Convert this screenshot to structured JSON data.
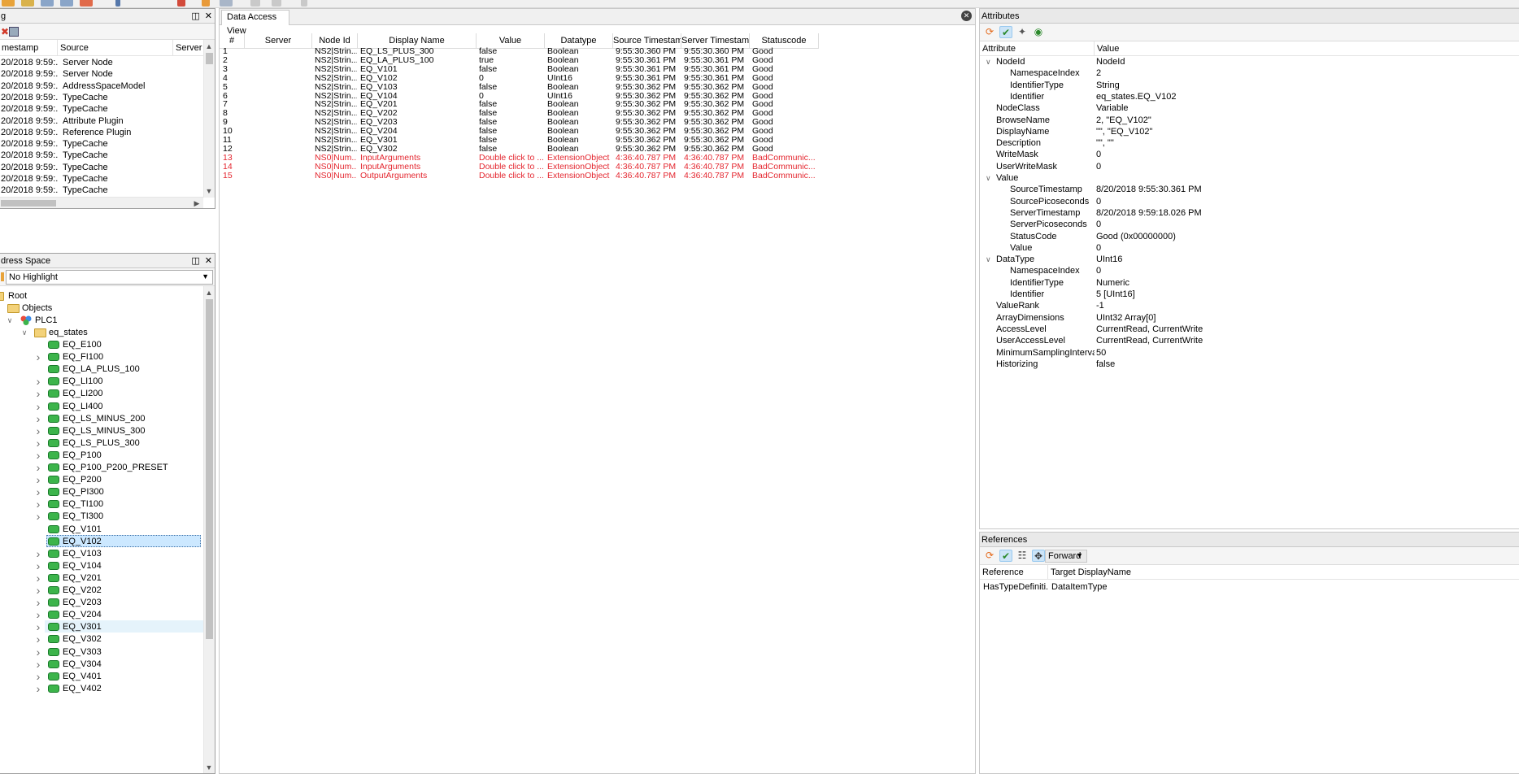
{
  "colors": {
    "good": "#000000",
    "bad": "#e4262f",
    "selection": "#cce8ff"
  },
  "log": {
    "title": "g",
    "columns": [
      "mestamp",
      "Source",
      "Server"
    ],
    "rows": [
      [
        "20/2018 9:59:...",
        "Server Node"
      ],
      [
        "20/2018 9:59:...",
        "Server Node"
      ],
      [
        "20/2018 9:59:...",
        "AddressSpaceModel"
      ],
      [
        "20/2018 9:59:...",
        "TypeCache"
      ],
      [
        "20/2018 9:59:...",
        "TypeCache"
      ],
      [
        "20/2018 9:59:...",
        "Attribute Plugin"
      ],
      [
        "20/2018 9:59:...",
        "Reference Plugin"
      ],
      [
        "20/2018 9:59:...",
        "TypeCache"
      ],
      [
        "20/2018 9:59:...",
        "TypeCache"
      ],
      [
        "20/2018 9:59:...",
        "TypeCache"
      ],
      [
        "20/2018 9:59:...",
        "TypeCache"
      ],
      [
        "20/2018 9:59:...",
        "TypeCache"
      ]
    ]
  },
  "address_space": {
    "title": "dress Space",
    "highlight": "No Highlight",
    "root": "Root",
    "objects": "Objects",
    "plc": "PLC1",
    "folder": "eq_states",
    "items": [
      {
        "label": "EQ_E100",
        "expandable": false
      },
      {
        "label": "EQ_FI100",
        "expandable": true
      },
      {
        "label": "EQ_LA_PLUS_100",
        "expandable": false
      },
      {
        "label": "EQ_LI100",
        "expandable": true
      },
      {
        "label": "EQ_LI200",
        "expandable": true
      },
      {
        "label": "EQ_LI400",
        "expandable": true
      },
      {
        "label": "EQ_LS_MINUS_200",
        "expandable": true
      },
      {
        "label": "EQ_LS_MINUS_300",
        "expandable": true
      },
      {
        "label": "EQ_LS_PLUS_300",
        "expandable": true
      },
      {
        "label": "EQ_P100",
        "expandable": true
      },
      {
        "label": "EQ_P100_P200_PRESET",
        "expandable": true
      },
      {
        "label": "EQ_P200",
        "expandable": true
      },
      {
        "label": "EQ_PI300",
        "expandable": true
      },
      {
        "label": "EQ_TI100",
        "expandable": true
      },
      {
        "label": "EQ_TI300",
        "expandable": true
      },
      {
        "label": "EQ_V101",
        "expandable": false
      },
      {
        "label": "EQ_V102",
        "expandable": false,
        "selected": true
      },
      {
        "label": "EQ_V103",
        "expandable": true
      },
      {
        "label": "EQ_V104",
        "expandable": true
      },
      {
        "label": "EQ_V201",
        "expandable": true
      },
      {
        "label": "EQ_V202",
        "expandable": true
      },
      {
        "label": "EQ_V203",
        "expandable": true
      },
      {
        "label": "EQ_V204",
        "expandable": true
      },
      {
        "label": "EQ_V301",
        "expandable": true,
        "hover": true
      },
      {
        "label": "EQ_V302",
        "expandable": true
      },
      {
        "label": "EQ_V303",
        "expandable": true
      },
      {
        "label": "EQ_V304",
        "expandable": true
      },
      {
        "label": "EQ_V401",
        "expandable": true
      },
      {
        "label": "EQ_V402",
        "expandable": true
      }
    ]
  },
  "data_access": {
    "tab": "Data Access View",
    "columns": [
      "#",
      "Server",
      "Node Id",
      "Display Name",
      "Value",
      "Datatype",
      "Source Timestamp",
      "Server Timestamp",
      "Statuscode"
    ],
    "rows": [
      {
        "n": "1",
        "node": "NS2|Strin...",
        "name": "EQ_LS_PLUS_300",
        "value": "false",
        "type": "Boolean",
        "src": "9:55:30.360 PM",
        "srv": "9:55:30.360 PM",
        "status": "Good",
        "bad": false
      },
      {
        "n": "2",
        "node": "NS2|Strin...",
        "name": "EQ_LA_PLUS_100",
        "value": "true",
        "type": "Boolean",
        "src": "9:55:30.361 PM",
        "srv": "9:55:30.361 PM",
        "status": "Good",
        "bad": false
      },
      {
        "n": "3",
        "node": "NS2|Strin...",
        "name": "EQ_V101",
        "value": "false",
        "type": "Boolean",
        "src": "9:55:30.361 PM",
        "srv": "9:55:30.361 PM",
        "status": "Good",
        "bad": false
      },
      {
        "n": "4",
        "node": "NS2|Strin...",
        "name": "EQ_V102",
        "value": "0",
        "type": "UInt16",
        "src": "9:55:30.361 PM",
        "srv": "9:55:30.361 PM",
        "status": "Good",
        "bad": false
      },
      {
        "n": "5",
        "node": "NS2|Strin...",
        "name": "EQ_V103",
        "value": "false",
        "type": "Boolean",
        "src": "9:55:30.362 PM",
        "srv": "9:55:30.362 PM",
        "status": "Good",
        "bad": false
      },
      {
        "n": "6",
        "node": "NS2|Strin...",
        "name": "EQ_V104",
        "value": "0",
        "type": "UInt16",
        "src": "9:55:30.362 PM",
        "srv": "9:55:30.362 PM",
        "status": "Good",
        "bad": false
      },
      {
        "n": "7",
        "node": "NS2|Strin...",
        "name": "EQ_V201",
        "value": "false",
        "type": "Boolean",
        "src": "9:55:30.362 PM",
        "srv": "9:55:30.362 PM",
        "status": "Good",
        "bad": false
      },
      {
        "n": "8",
        "node": "NS2|Strin...",
        "name": "EQ_V202",
        "value": "false",
        "type": "Boolean",
        "src": "9:55:30.362 PM",
        "srv": "9:55:30.362 PM",
        "status": "Good",
        "bad": false
      },
      {
        "n": "9",
        "node": "NS2|Strin...",
        "name": "EQ_V203",
        "value": "false",
        "type": "Boolean",
        "src": "9:55:30.362 PM",
        "srv": "9:55:30.362 PM",
        "status": "Good",
        "bad": false
      },
      {
        "n": "10",
        "node": "NS2|Strin...",
        "name": "EQ_V204",
        "value": "false",
        "type": "Boolean",
        "src": "9:55:30.362 PM",
        "srv": "9:55:30.362 PM",
        "status": "Good",
        "bad": false
      },
      {
        "n": "11",
        "node": "NS2|Strin...",
        "name": "EQ_V301",
        "value": "false",
        "type": "Boolean",
        "src": "9:55:30.362 PM",
        "srv": "9:55:30.362 PM",
        "status": "Good",
        "bad": false
      },
      {
        "n": "12",
        "node": "NS2|Strin...",
        "name": "EQ_V302",
        "value": "false",
        "type": "Boolean",
        "src": "9:55:30.362 PM",
        "srv": "9:55:30.362 PM",
        "status": "Good",
        "bad": false
      },
      {
        "n": "13",
        "node": "NS0|Num...",
        "name": "InputArguments",
        "value": "Double click to ...",
        "type": "ExtensionObject",
        "src": "4:36:40.787 PM",
        "srv": "4:36:40.787 PM",
        "status": "BadCommunic...",
        "bad": true
      },
      {
        "n": "14",
        "node": "NS0|Num...",
        "name": "InputArguments",
        "value": "Double click to ...",
        "type": "ExtensionObject",
        "src": "4:36:40.787 PM",
        "srv": "4:36:40.787 PM",
        "status": "BadCommunic...",
        "bad": true
      },
      {
        "n": "15",
        "node": "NS0|Num...",
        "name": "OutputArguments",
        "value": "Double click to ...",
        "type": "ExtensionObject",
        "src": "4:36:40.787 PM",
        "srv": "4:36:40.787 PM",
        "status": "BadCommunic...",
        "bad": true
      }
    ]
  },
  "attributes": {
    "title": "Attributes",
    "col_attribute": "Attribute",
    "col_value": "Value",
    "rows": [
      {
        "name": "NodeId",
        "value": "NodeId",
        "level": 0,
        "exp": true
      },
      {
        "name": "NamespaceIndex",
        "value": "2",
        "level": 1
      },
      {
        "name": "IdentifierType",
        "value": "String",
        "level": 1
      },
      {
        "name": "Identifier",
        "value": "eq_states.EQ_V102",
        "level": 1
      },
      {
        "name": "NodeClass",
        "value": "Variable",
        "level": 0
      },
      {
        "name": "BrowseName",
        "value": "2, \"EQ_V102\"",
        "level": 0
      },
      {
        "name": "DisplayName",
        "value": "\"\", \"EQ_V102\"",
        "level": 0
      },
      {
        "name": "Description",
        "value": "\"\", \"\"",
        "level": 0
      },
      {
        "name": "WriteMask",
        "value": "0",
        "level": 0
      },
      {
        "name": "UserWriteMask",
        "value": "0",
        "level": 0
      },
      {
        "name": "Value",
        "value": "",
        "level": 0,
        "exp": true
      },
      {
        "name": "SourceTimestamp",
        "value": "8/20/2018 9:55:30.361 PM",
        "level": 1
      },
      {
        "name": "SourcePicoseconds",
        "value": "0",
        "level": 1
      },
      {
        "name": "ServerTimestamp",
        "value": "8/20/2018 9:59:18.026 PM",
        "level": 1
      },
      {
        "name": "ServerPicoseconds",
        "value": "0",
        "level": 1
      },
      {
        "name": "StatusCode",
        "value": "Good (0x00000000)",
        "level": 1
      },
      {
        "name": "Value",
        "value": "0",
        "level": 1
      },
      {
        "name": "DataType",
        "value": "UInt16",
        "level": 0,
        "exp": true
      },
      {
        "name": "NamespaceIndex",
        "value": "0",
        "level": 1
      },
      {
        "name": "IdentifierType",
        "value": "Numeric",
        "level": 1
      },
      {
        "name": "Identifier",
        "value": "5 [UInt16]",
        "level": 1
      },
      {
        "name": "ValueRank",
        "value": "-1",
        "level": 0
      },
      {
        "name": "ArrayDimensions",
        "value": "UInt32 Array[0]",
        "level": 0
      },
      {
        "name": "AccessLevel",
        "value": "CurrentRead, CurrentWrite",
        "level": 0
      },
      {
        "name": "UserAccessLevel",
        "value": "CurrentRead, CurrentWrite",
        "level": 0
      },
      {
        "name": "MinimumSamplingInterval",
        "value": "50",
        "level": 0
      },
      {
        "name": "Historizing",
        "value": "false",
        "level": 0
      }
    ]
  },
  "references": {
    "title": "References",
    "direction": "Forward",
    "col_reference": "Reference",
    "col_target": "Target DisplayName",
    "rows": [
      {
        "reference": "HasTypeDefiniti...",
        "target": "DataItemType"
      }
    ]
  }
}
